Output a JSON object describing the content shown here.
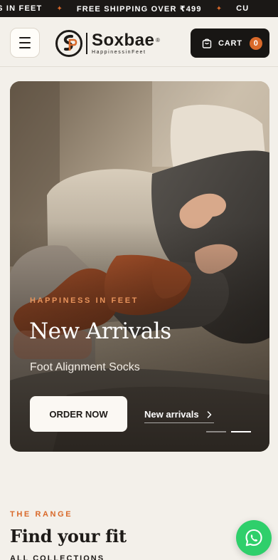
{
  "announcement": {
    "items": [
      "ESS IN FEET",
      "FREE SHIPPING OVER ₹499",
      "CU"
    ],
    "separator": "✦"
  },
  "header": {
    "brand_name": "Soxbae",
    "brand_mark": "®",
    "brand_tagline": "HappinessinFeet",
    "cart_label": "CART",
    "cart_count": "0"
  },
  "hero": {
    "eyebrow": "HAPPINESS IN FEET",
    "title": "New Arrivals",
    "subtitle": "Foot Alignment Socks",
    "primary_cta": "ORDER NOW",
    "secondary_cta": "New arrivals",
    "slides_total": 2,
    "slide_active": 2
  },
  "range": {
    "eyebrow": "THE RANGE",
    "title": "Find your fit",
    "link": "ALL COLLECTIONS"
  },
  "colors": {
    "accent": "#d9692a",
    "dark": "#181614",
    "background": "#f3f0ea",
    "whatsapp": "#2fcf6b"
  },
  "icons": [
    "hamburger-menu-icon",
    "soxbae-logo-mark",
    "shopping-bag-icon",
    "chevron-right-icon",
    "whatsapp-icon"
  ]
}
